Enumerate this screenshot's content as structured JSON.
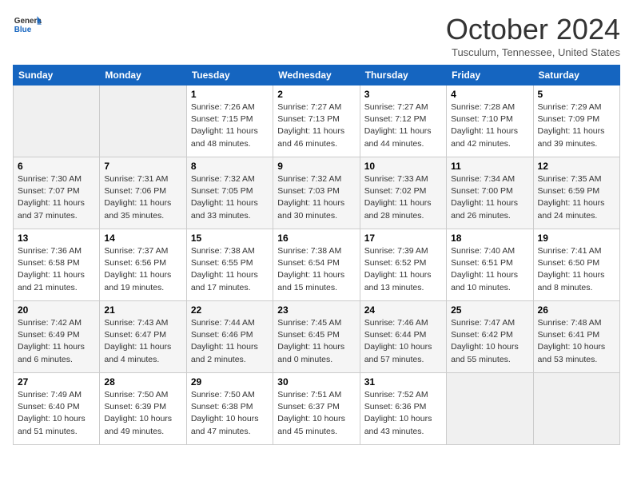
{
  "logo": {
    "line1": "General",
    "line2": "Blue"
  },
  "title": "October 2024",
  "location": "Tusculum, Tennessee, United States",
  "days_header": [
    "Sunday",
    "Monday",
    "Tuesday",
    "Wednesday",
    "Thursday",
    "Friday",
    "Saturday"
  ],
  "weeks": [
    [
      {
        "day": "",
        "info": ""
      },
      {
        "day": "",
        "info": ""
      },
      {
        "day": "1",
        "info": "Sunrise: 7:26 AM\nSunset: 7:15 PM\nDaylight: 11 hours and 48 minutes."
      },
      {
        "day": "2",
        "info": "Sunrise: 7:27 AM\nSunset: 7:13 PM\nDaylight: 11 hours and 46 minutes."
      },
      {
        "day": "3",
        "info": "Sunrise: 7:27 AM\nSunset: 7:12 PM\nDaylight: 11 hours and 44 minutes."
      },
      {
        "day": "4",
        "info": "Sunrise: 7:28 AM\nSunset: 7:10 PM\nDaylight: 11 hours and 42 minutes."
      },
      {
        "day": "5",
        "info": "Sunrise: 7:29 AM\nSunset: 7:09 PM\nDaylight: 11 hours and 39 minutes."
      }
    ],
    [
      {
        "day": "6",
        "info": "Sunrise: 7:30 AM\nSunset: 7:07 PM\nDaylight: 11 hours and 37 minutes."
      },
      {
        "day": "7",
        "info": "Sunrise: 7:31 AM\nSunset: 7:06 PM\nDaylight: 11 hours and 35 minutes."
      },
      {
        "day": "8",
        "info": "Sunrise: 7:32 AM\nSunset: 7:05 PM\nDaylight: 11 hours and 33 minutes."
      },
      {
        "day": "9",
        "info": "Sunrise: 7:32 AM\nSunset: 7:03 PM\nDaylight: 11 hours and 30 minutes."
      },
      {
        "day": "10",
        "info": "Sunrise: 7:33 AM\nSunset: 7:02 PM\nDaylight: 11 hours and 28 minutes."
      },
      {
        "day": "11",
        "info": "Sunrise: 7:34 AM\nSunset: 7:00 PM\nDaylight: 11 hours and 26 minutes."
      },
      {
        "day": "12",
        "info": "Sunrise: 7:35 AM\nSunset: 6:59 PM\nDaylight: 11 hours and 24 minutes."
      }
    ],
    [
      {
        "day": "13",
        "info": "Sunrise: 7:36 AM\nSunset: 6:58 PM\nDaylight: 11 hours and 21 minutes."
      },
      {
        "day": "14",
        "info": "Sunrise: 7:37 AM\nSunset: 6:56 PM\nDaylight: 11 hours and 19 minutes."
      },
      {
        "day": "15",
        "info": "Sunrise: 7:38 AM\nSunset: 6:55 PM\nDaylight: 11 hours and 17 minutes."
      },
      {
        "day": "16",
        "info": "Sunrise: 7:38 AM\nSunset: 6:54 PM\nDaylight: 11 hours and 15 minutes."
      },
      {
        "day": "17",
        "info": "Sunrise: 7:39 AM\nSunset: 6:52 PM\nDaylight: 11 hours and 13 minutes."
      },
      {
        "day": "18",
        "info": "Sunrise: 7:40 AM\nSunset: 6:51 PM\nDaylight: 11 hours and 10 minutes."
      },
      {
        "day": "19",
        "info": "Sunrise: 7:41 AM\nSunset: 6:50 PM\nDaylight: 11 hours and 8 minutes."
      }
    ],
    [
      {
        "day": "20",
        "info": "Sunrise: 7:42 AM\nSunset: 6:49 PM\nDaylight: 11 hours and 6 minutes."
      },
      {
        "day": "21",
        "info": "Sunrise: 7:43 AM\nSunset: 6:47 PM\nDaylight: 11 hours and 4 minutes."
      },
      {
        "day": "22",
        "info": "Sunrise: 7:44 AM\nSunset: 6:46 PM\nDaylight: 11 hours and 2 minutes."
      },
      {
        "day": "23",
        "info": "Sunrise: 7:45 AM\nSunset: 6:45 PM\nDaylight: 11 hours and 0 minutes."
      },
      {
        "day": "24",
        "info": "Sunrise: 7:46 AM\nSunset: 6:44 PM\nDaylight: 10 hours and 57 minutes."
      },
      {
        "day": "25",
        "info": "Sunrise: 7:47 AM\nSunset: 6:42 PM\nDaylight: 10 hours and 55 minutes."
      },
      {
        "day": "26",
        "info": "Sunrise: 7:48 AM\nSunset: 6:41 PM\nDaylight: 10 hours and 53 minutes."
      }
    ],
    [
      {
        "day": "27",
        "info": "Sunrise: 7:49 AM\nSunset: 6:40 PM\nDaylight: 10 hours and 51 minutes."
      },
      {
        "day": "28",
        "info": "Sunrise: 7:50 AM\nSunset: 6:39 PM\nDaylight: 10 hours and 49 minutes."
      },
      {
        "day": "29",
        "info": "Sunrise: 7:50 AM\nSunset: 6:38 PM\nDaylight: 10 hours and 47 minutes."
      },
      {
        "day": "30",
        "info": "Sunrise: 7:51 AM\nSunset: 6:37 PM\nDaylight: 10 hours and 45 minutes."
      },
      {
        "day": "31",
        "info": "Sunrise: 7:52 AM\nSunset: 6:36 PM\nDaylight: 10 hours and 43 minutes."
      },
      {
        "day": "",
        "info": ""
      },
      {
        "day": "",
        "info": ""
      }
    ]
  ]
}
